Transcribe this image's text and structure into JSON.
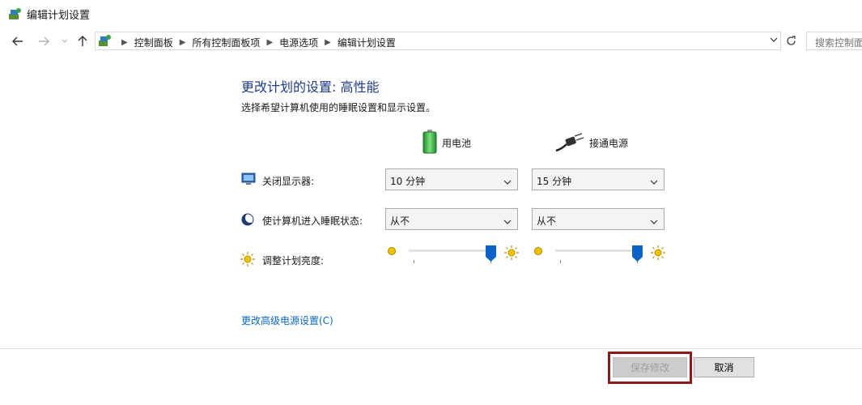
{
  "window": {
    "title": "编辑计划设置"
  },
  "nav": {
    "breadcrumbs": [
      "控制面板",
      "所有控制面板项",
      "电源选项",
      "编辑计划设置"
    ],
    "search_placeholder": "搜索控制面板"
  },
  "main": {
    "heading": "更改计划的设置: 高性能",
    "subtext": "选择希望计算机使用的睡眠设置和显示设置。",
    "columns": {
      "battery": "用电池",
      "plugged": "接通电源"
    },
    "rows": {
      "display": {
        "label": "关闭显示器:",
        "battery_value": "10 分钟",
        "plugged_value": "15 分钟"
      },
      "sleep": {
        "label": "使计算机进入睡眠状态:",
        "battery_value": "从不",
        "plugged_value": "从不"
      },
      "brightness": {
        "label": "调整计划亮度:",
        "battery_level_percent": 100,
        "plugged_level_percent": 100
      }
    },
    "advanced_link": "更改高级电源设置(C)"
  },
  "footer": {
    "save_label": "保存修改",
    "cancel_label": "取消"
  },
  "colors": {
    "heading": "#1e3a8a",
    "link": "#0a66c2",
    "slider_thumb": "#0b63c9",
    "highlight": "#8b1a1a"
  }
}
